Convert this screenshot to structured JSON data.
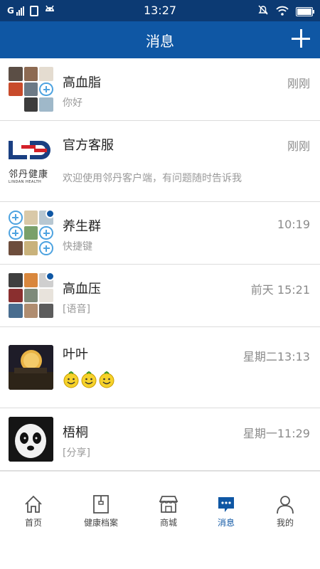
{
  "status_bar": {
    "signal_label": "G",
    "time": "13:27",
    "icons": [
      "signal-icon",
      "sim-icon",
      "android-icon",
      "mute-icon",
      "wifi-icon",
      "battery-icon"
    ]
  },
  "header": {
    "title": "消息",
    "add_icon": "plus-icon"
  },
  "conversations": [
    {
      "name": "高血脂",
      "time": "刚刚",
      "preview": "你好",
      "unread": false
    },
    {
      "name": "官方客服",
      "time": "刚刚",
      "preview": "欢迎使用邻丹客户端，有问题随时告诉我",
      "unread": false,
      "logo_text": "邻丹健康",
      "logo_subtext": "LINDAN HEALTH"
    },
    {
      "name": "养生群",
      "time": "10:19",
      "preview": "快捷键",
      "unread": true
    },
    {
      "name": "高血压",
      "time": "前天 15:21",
      "preview": "[语音]",
      "unread": true
    },
    {
      "name": "叶叶",
      "time": "星期二13:13",
      "preview": "",
      "preview_icons": [
        "smiley-icon",
        "smiley-icon",
        "smiley-icon"
      ],
      "unread": false
    },
    {
      "name": "梧桐",
      "time": "星期一11:29",
      "preview": "[分享]",
      "unread": false
    }
  ],
  "tabs": [
    {
      "label": "首页",
      "icon": "home-icon",
      "active": false
    },
    {
      "label": "健康档案",
      "icon": "file-icon",
      "active": false
    },
    {
      "label": "商城",
      "icon": "shop-icon",
      "active": false
    },
    {
      "label": "消息",
      "icon": "chat-icon",
      "active": true
    },
    {
      "label": "我的",
      "icon": "user-icon",
      "active": false
    }
  ],
  "colors": {
    "statusbar": "#0c3a73",
    "navbar": "#0f57a4",
    "accent": "#0f57a4",
    "muted_text": "#9a9a9a"
  }
}
